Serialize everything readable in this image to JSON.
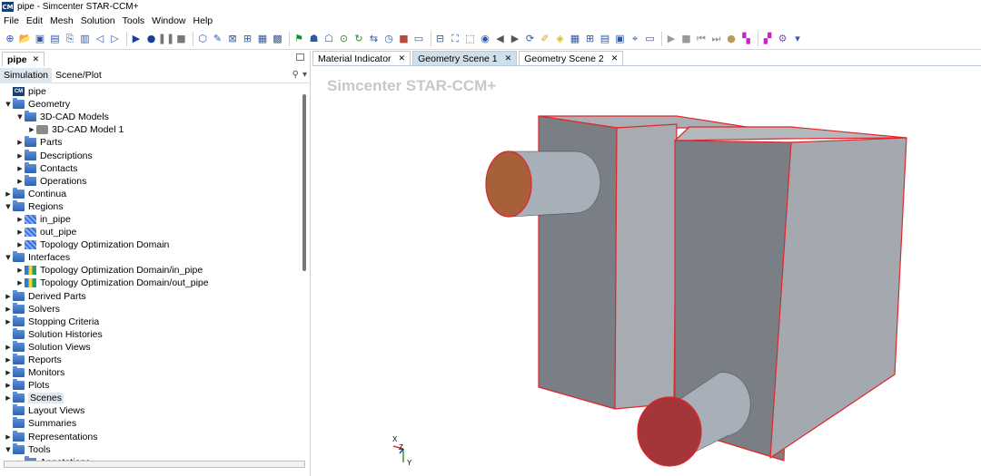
{
  "window": {
    "title": "pipe - Simcenter STAR-CCM+",
    "logo": "CM"
  },
  "menu": [
    "File",
    "Edit",
    "Mesh",
    "Solution",
    "Tools",
    "Window",
    "Help"
  ],
  "toolbar_icons": [
    "new-sim-icon",
    "open-icon",
    "save-icon",
    "save-as-icon",
    "copy-icon",
    "paste-icon",
    "back-icon",
    "forward-icon",
    "run-icon",
    "step-icon",
    "pause-icon",
    "stop-icon",
    "mesh-icon",
    "repair-icon",
    "split-icon",
    "field-icon",
    "graph-icon",
    "table-icon",
    "flag-icon",
    "runner-icon",
    "runner2-icon",
    "zoom-icon",
    "refresh-icon",
    "wrap-icon",
    "timer-icon",
    "record-icon",
    "scene-icon",
    "fit-icon",
    "fullscreen-icon",
    "select-icon",
    "camera-icon",
    "left-icon",
    "right-icon",
    "rotate-icon",
    "pen-icon",
    "eye-icon",
    "grid-icon",
    "grid2-icon",
    "layout-icon",
    "layout2-icon",
    "pick-icon",
    "ruler-icon",
    "play-icon",
    "stop2-icon",
    "prev-icon",
    "next-icon",
    "dot-icon",
    "layers-icon",
    "layers2-icon",
    "gear-icon",
    "more-icon"
  ],
  "left_panel": {
    "tab_label": "pipe",
    "subtabs": [
      "Simulation",
      "Scene/Plot"
    ],
    "tree": [
      {
        "label": "pipe",
        "level": 0,
        "toggle": "",
        "icon": "root"
      },
      {
        "label": "Geometry",
        "level": 0,
        "toggle": "▼",
        "icon": "folder"
      },
      {
        "label": "3D-CAD Models",
        "level": 1,
        "toggle": "▼",
        "icon": "folder"
      },
      {
        "label": "3D-CAD Model 1",
        "level": 2,
        "toggle": "▶",
        "icon": "cad"
      },
      {
        "label": "Parts",
        "level": 1,
        "toggle": "▶",
        "icon": "folder"
      },
      {
        "label": "Descriptions",
        "level": 1,
        "toggle": "▶",
        "icon": "folder"
      },
      {
        "label": "Contacts",
        "level": 1,
        "toggle": "▶",
        "icon": "folder"
      },
      {
        "label": "Operations",
        "level": 1,
        "toggle": "▶",
        "icon": "folder"
      },
      {
        "label": "Continua",
        "level": 0,
        "toggle": "▶",
        "icon": "folder"
      },
      {
        "label": "Regions",
        "level": 0,
        "toggle": "▼",
        "icon": "folder"
      },
      {
        "label": "in_pipe",
        "level": 1,
        "toggle": "▶",
        "icon": "region"
      },
      {
        "label": "out_pipe",
        "level": 1,
        "toggle": "▶",
        "icon": "region"
      },
      {
        "label": "Topology Optimization Domain",
        "level": 1,
        "toggle": "▶",
        "icon": "region"
      },
      {
        "label": "Interfaces",
        "level": 0,
        "toggle": "▼",
        "icon": "folder"
      },
      {
        "label": "Topology Optimization Domain/in_pipe",
        "level": 1,
        "toggle": "▶",
        "icon": "iface"
      },
      {
        "label": "Topology Optimization Domain/out_pipe",
        "level": 1,
        "toggle": "▶",
        "icon": "iface"
      },
      {
        "label": "Derived Parts",
        "level": 0,
        "toggle": "▶",
        "icon": "folder"
      },
      {
        "label": "Solvers",
        "level": 0,
        "toggle": "▶",
        "icon": "folder"
      },
      {
        "label": "Stopping Criteria",
        "level": 0,
        "toggle": "▶",
        "icon": "folder"
      },
      {
        "label": "Solution Histories",
        "level": 0,
        "toggle": "",
        "icon": "folder"
      },
      {
        "label": "Solution Views",
        "level": 0,
        "toggle": "▶",
        "icon": "folder"
      },
      {
        "label": "Reports",
        "level": 0,
        "toggle": "▶",
        "icon": "folder"
      },
      {
        "label": "Monitors",
        "level": 0,
        "toggle": "▶",
        "icon": "folder"
      },
      {
        "label": "Plots",
        "level": 0,
        "toggle": "▶",
        "icon": "folder"
      },
      {
        "label": "Scenes",
        "level": 0,
        "toggle": "▶",
        "icon": "folder",
        "highlight": true
      },
      {
        "label": "Layout Views",
        "level": 0,
        "toggle": "",
        "icon": "folder"
      },
      {
        "label": "Summaries",
        "level": 0,
        "toggle": "",
        "icon": "folder"
      },
      {
        "label": "Representations",
        "level": 0,
        "toggle": "▶",
        "icon": "folder"
      },
      {
        "label": "Tools",
        "level": 0,
        "toggle": "▼",
        "icon": "folder"
      },
      {
        "label": "Annotations",
        "level": 1,
        "toggle": "▶",
        "icon": "folder"
      }
    ]
  },
  "scene_tabs": [
    {
      "label": "Material Indicator",
      "active": false
    },
    {
      "label": "Geometry Scene 1",
      "active": true
    },
    {
      "label": "Geometry Scene 2",
      "active": false
    }
  ],
  "scene": {
    "watermark": "Simcenter STAR-CCM+",
    "axes": {
      "x": "X",
      "y": "Y",
      "z": "Z"
    },
    "colors": {
      "body": "#a2a8ae",
      "edge": "#e0262b",
      "inlet": "#a8603a",
      "outlet": "#a3353b"
    }
  }
}
